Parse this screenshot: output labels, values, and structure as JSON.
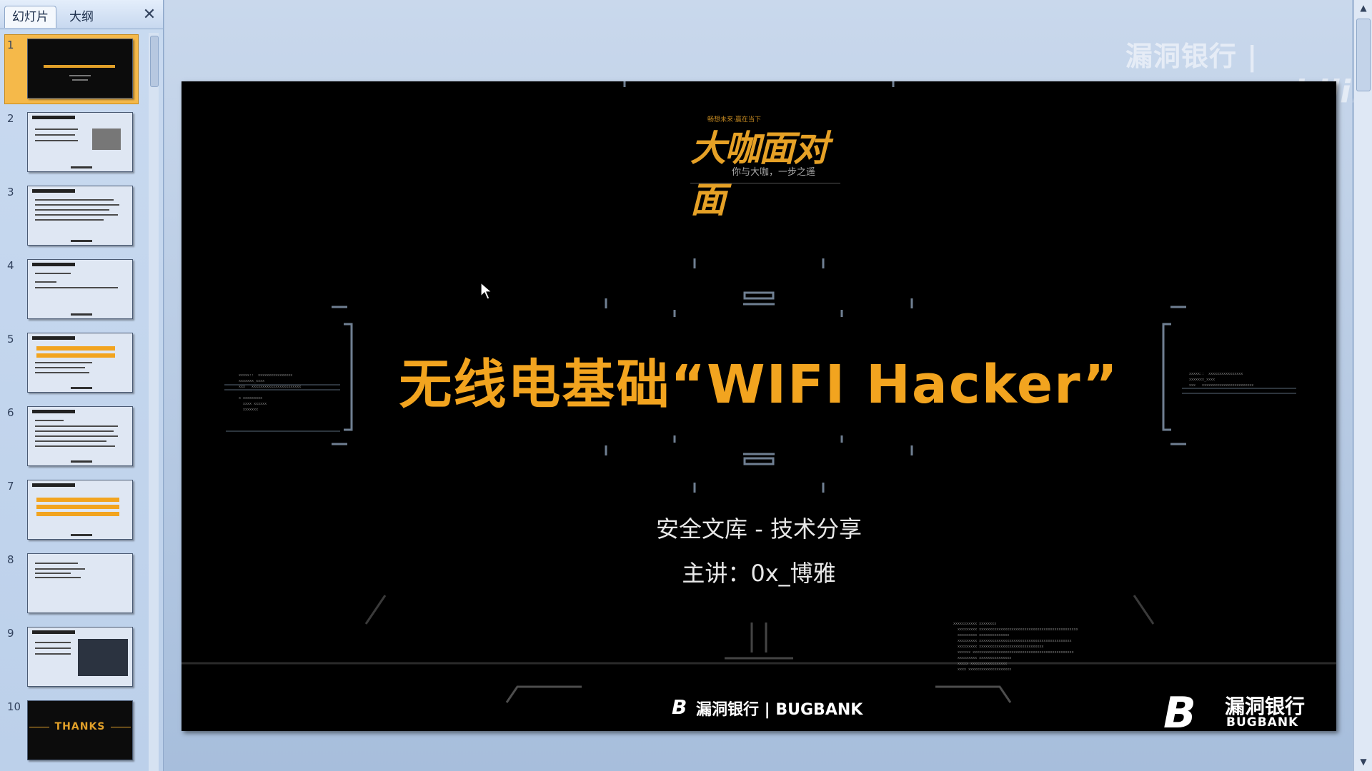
{
  "panel": {
    "tabs": [
      {
        "label": "幻灯片"
      },
      {
        "label": "大纲"
      }
    ],
    "close_symbol": "✕",
    "thumbnails": [
      {
        "number": "1",
        "selected": true
      },
      {
        "number": "2"
      },
      {
        "number": "3"
      },
      {
        "number": "4"
      },
      {
        "number": "5"
      },
      {
        "number": "6"
      },
      {
        "number": "7"
      },
      {
        "number": "8"
      },
      {
        "number": "9"
      },
      {
        "number": "10",
        "text": "THANKS"
      }
    ]
  },
  "watermark": {
    "text": "漏洞银行 | BUGBANK",
    "bili": "bilibili"
  },
  "slide": {
    "logo_small": "畅想未来·赢在当下",
    "logo_big": "大咖面对面",
    "logo_sub": "你与大咖，一步之遥",
    "title": "无线电基础“WIFI Hacker”",
    "subtitle": "安全文库 - 技术分享",
    "presenter": "主讲：0x_博雅",
    "footer_mark": "B",
    "footer_text": "漏洞银行 | BUGBANK",
    "corner_mark": "B",
    "corner_cn": "漏洞银行",
    "corner_en": "BUGBANK"
  },
  "colors": {
    "accent": "#f2a41f",
    "slide_bg": "#000000",
    "panel_bg": "#c9daf0"
  },
  "icons": {
    "close": "close-icon",
    "cursor": "cursor-icon"
  }
}
